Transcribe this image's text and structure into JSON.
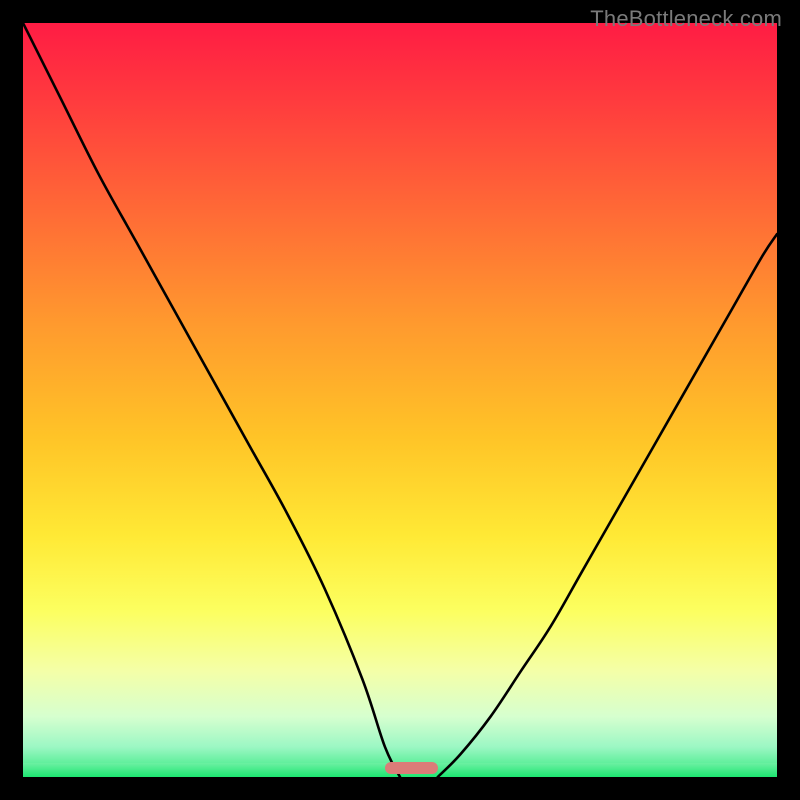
{
  "watermark": "TheBottleneck.com",
  "chart_data": {
    "type": "line",
    "title": "",
    "xlabel": "",
    "ylabel": "",
    "xlim": [
      0,
      100
    ],
    "ylim": [
      0,
      100
    ],
    "grid": false,
    "legend": false,
    "series": [
      {
        "name": "left-branch",
        "x": [
          0,
          5,
          10,
          15,
          20,
          25,
          30,
          35,
          40,
          45,
          48,
          50
        ],
        "values": [
          100,
          90,
          80,
          71,
          62,
          53,
          44,
          35,
          25,
          13,
          4,
          0
        ]
      },
      {
        "name": "right-branch",
        "x": [
          55,
          58,
          62,
          66,
          70,
          74,
          78,
          82,
          86,
          90,
          94,
          98,
          100
        ],
        "values": [
          0,
          3,
          8,
          14,
          20,
          27,
          34,
          41,
          48,
          55,
          62,
          69,
          72
        ]
      }
    ],
    "optimum_marker": {
      "x_start": 48,
      "x_end": 55,
      "y": 0
    },
    "gradient_colors": {
      "top": "#ff1c44",
      "mid_upper": "#ff9a2e",
      "mid": "#ffe935",
      "mid_lower": "#f4ffa8",
      "bottom": "#1de671"
    }
  }
}
